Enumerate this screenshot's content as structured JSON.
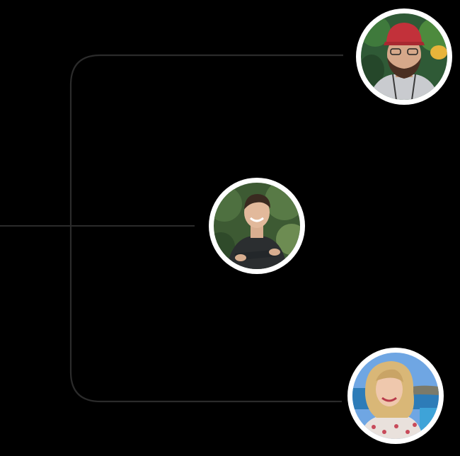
{
  "diagram": {
    "background_color": "#000000",
    "connector_color": "#2b2b2b",
    "ring_color": "#ffffff",
    "nodes": [
      {
        "id": "top",
        "image": "portrait-man-red-cap"
      },
      {
        "id": "middle",
        "image": "portrait-young-man-smiling"
      },
      {
        "id": "bottom",
        "image": "portrait-woman-blonde-seaside"
      }
    ]
  }
}
